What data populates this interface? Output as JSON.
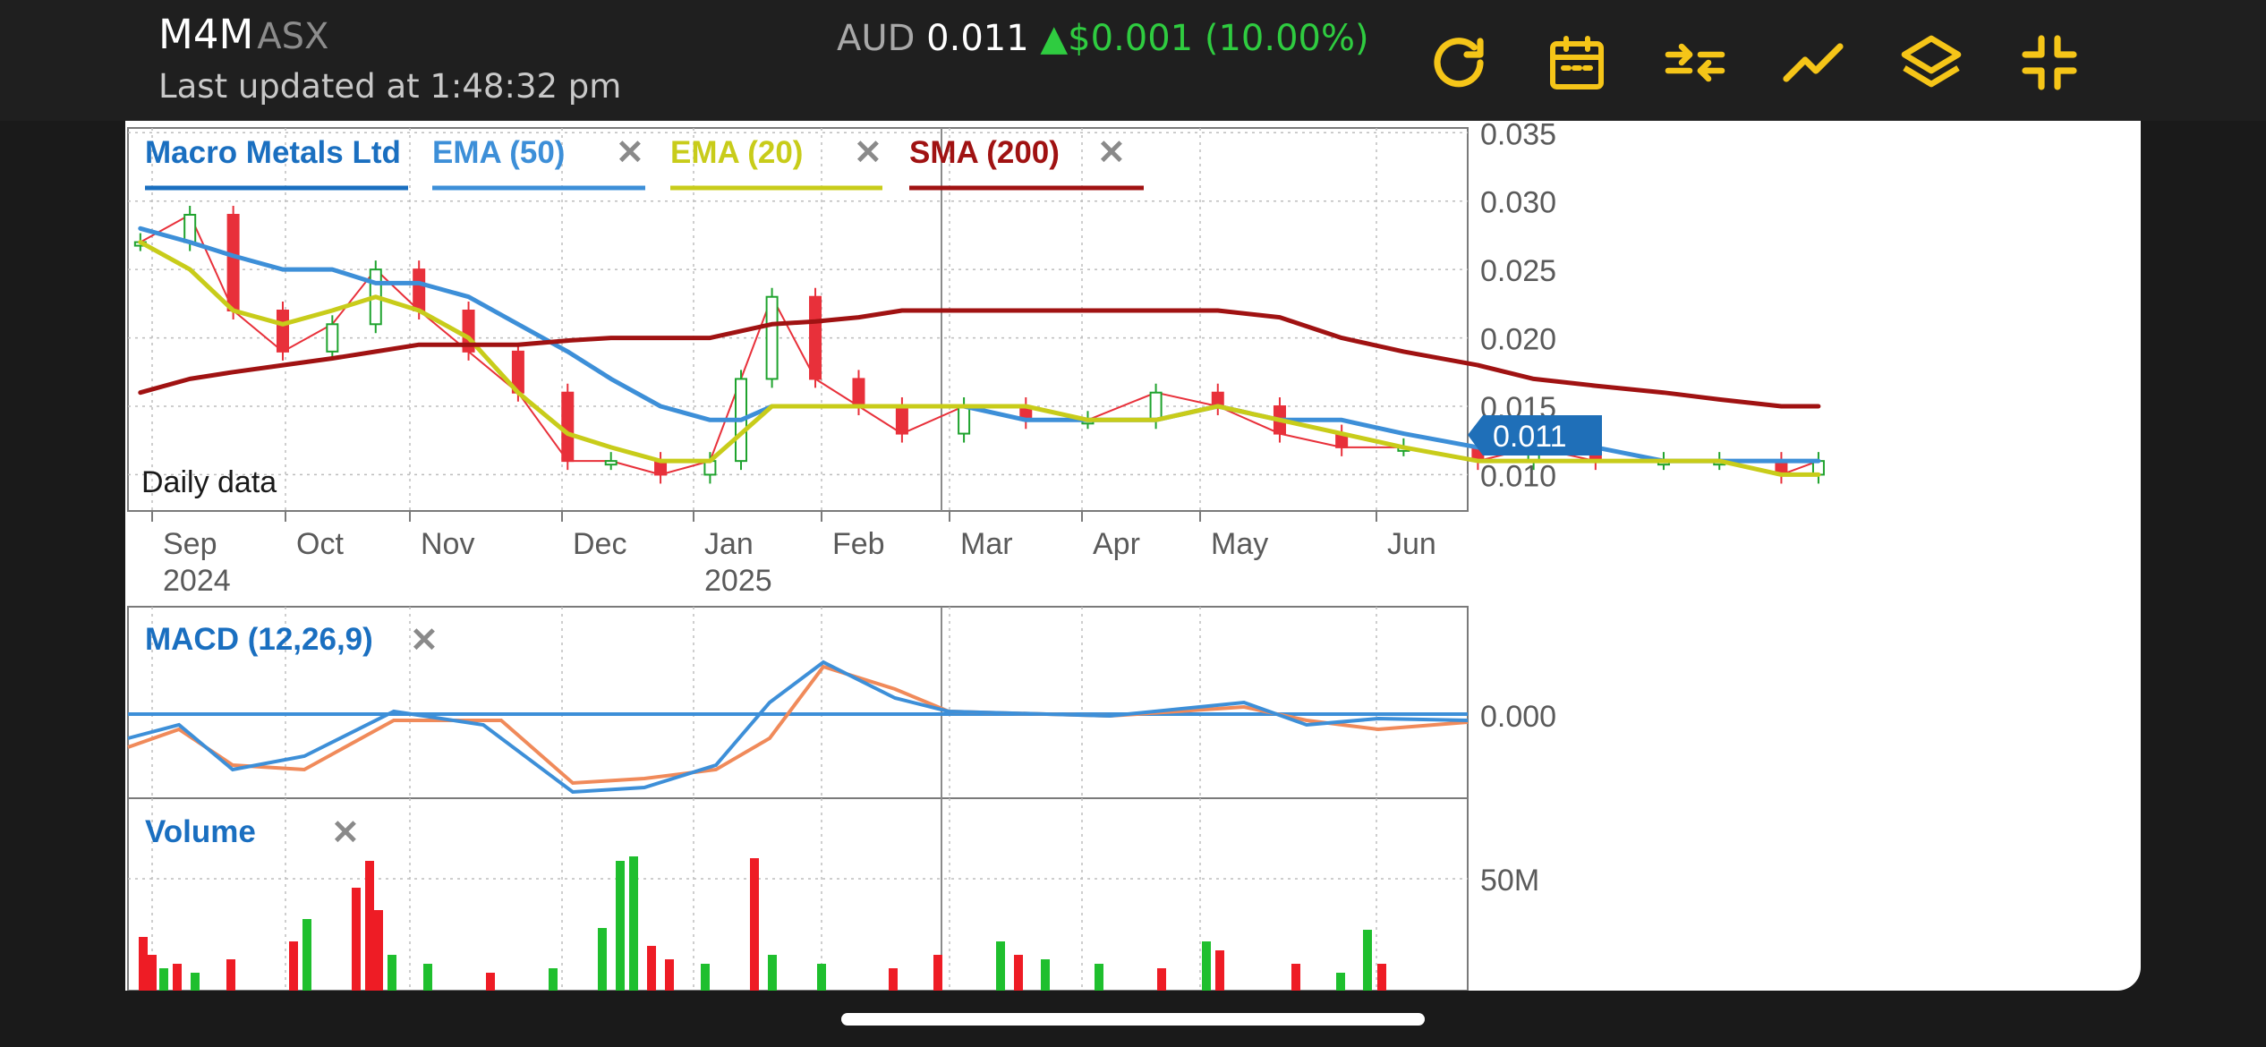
{
  "header": {
    "ticker": "M4M",
    "exchange": "ASX",
    "updated": "Last updated at 1:48:32 pm",
    "currency": "AUD",
    "price": "0.011",
    "change_arrow": "▲",
    "change": "$0.001",
    "change_pct": "(10.00%)"
  },
  "toolbar": {
    "icons": [
      "refresh-icon",
      "calendar-icon",
      "compare-icon",
      "indicator-line-icon",
      "layers-icon",
      "exit-fullscreen-icon"
    ],
    "color": "#f5c518"
  },
  "legend": {
    "items": [
      {
        "label": "Macro Metals Ltd",
        "color": "#1a6fc0",
        "removable": false
      },
      {
        "label": "EMA (50)",
        "color": "#3d8fd8",
        "removable": true
      },
      {
        "label": "EMA (20)",
        "color": "#c8cc1a",
        "removable": true
      },
      {
        "label": "SMA (200)",
        "color": "#a01212",
        "removable": true
      }
    ],
    "close_glyph": "✕"
  },
  "price_panel": {
    "footnote": "Daily data",
    "current_price_tag": "0.011",
    "y_ticks": [
      "0.035",
      "0.030",
      "0.025",
      "0.020",
      "0.015",
      "0.010"
    ],
    "months": [
      {
        "label": "Sep",
        "year": "2024"
      },
      {
        "label": "Oct",
        "year": ""
      },
      {
        "label": "Nov",
        "year": ""
      },
      {
        "label": "Dec",
        "year": ""
      },
      {
        "label": "Jan",
        "year": "2025"
      },
      {
        "label": "Feb",
        "year": ""
      },
      {
        "label": "Mar",
        "year": ""
      },
      {
        "label": "Apr",
        "year": ""
      },
      {
        "label": "May",
        "year": ""
      },
      {
        "label": "Jun",
        "year": ""
      }
    ]
  },
  "macd_panel": {
    "label": "MACD (12,26,9)",
    "y_tick": "0.000"
  },
  "volume_panel": {
    "label": "Volume",
    "y_tick": "50M"
  },
  "chart_data": {
    "type": "line",
    "title": "Macro Metals Ltd",
    "ylim": [
      0.008,
      0.036
    ],
    "x": [
      "2024-08-28",
      "2024-09-05",
      "2024-09-12",
      "2024-09-20",
      "2024-09-28",
      "2024-10-05",
      "2024-10-12",
      "2024-10-20",
      "2024-10-28",
      "2024-11-05",
      "2024-11-12",
      "2024-11-20",
      "2024-11-28",
      "2024-12-03",
      "2024-12-08",
      "2024-12-15",
      "2024-12-22",
      "2024-12-29",
      "2025-01-08",
      "2025-01-18",
      "2025-01-28",
      "2025-02-08",
      "2025-02-18",
      "2025-02-28",
      "2025-03-10",
      "2025-03-20",
      "2025-04-01",
      "2025-04-10",
      "2025-04-20",
      "2025-05-01",
      "2025-05-10",
      "2025-05-20",
      "2025-05-26"
    ],
    "series": [
      {
        "name": "Macro Metals Ltd",
        "color": "#1a6fc0",
        "values": [
          0.027,
          0.029,
          0.022,
          0.019,
          0.021,
          0.025,
          0.022,
          0.019,
          0.016,
          0.011,
          0.011,
          0.01,
          0.011,
          0.017,
          0.023,
          0.017,
          0.015,
          0.013,
          0.015,
          0.014,
          0.014,
          0.016,
          0.015,
          0.013,
          0.012,
          0.012,
          0.011,
          0.012,
          0.011,
          0.011,
          0.011,
          0.01,
          0.011
        ]
      },
      {
        "name": "EMA (50)",
        "color": "#3d8fd8",
        "values": [
          0.028,
          0.027,
          0.026,
          0.025,
          0.025,
          0.024,
          0.024,
          0.023,
          0.021,
          0.019,
          0.017,
          0.015,
          0.014,
          0.014,
          0.015,
          0.015,
          0.015,
          0.015,
          0.015,
          0.014,
          0.014,
          0.014,
          0.015,
          0.014,
          0.014,
          0.013,
          0.012,
          0.012,
          0.012,
          0.011,
          0.011,
          0.011,
          0.011
        ]
      },
      {
        "name": "EMA (20)",
        "color": "#c8cc1a",
        "values": [
          0.027,
          0.025,
          0.022,
          0.021,
          0.022,
          0.023,
          0.022,
          0.02,
          0.016,
          0.013,
          0.012,
          0.011,
          0.011,
          0.013,
          0.015,
          0.015,
          0.015,
          0.015,
          0.015,
          0.015,
          0.014,
          0.014,
          0.015,
          0.014,
          0.013,
          0.012,
          0.011,
          0.011,
          0.011,
          0.011,
          0.011,
          0.01,
          0.01
        ]
      },
      {
        "name": "SMA (200)",
        "color": "#a01212",
        "values": [
          0.016,
          0.017,
          0.0175,
          0.018,
          0.0185,
          0.019,
          0.0195,
          0.0195,
          0.0195,
          0.0198,
          0.02,
          0.02,
          0.02,
          0.0205,
          0.021,
          0.0212,
          0.0215,
          0.022,
          0.022,
          0.022,
          0.022,
          0.022,
          0.022,
          0.0215,
          0.02,
          0.019,
          0.018,
          0.017,
          0.0165,
          0.016,
          0.0155,
          0.015,
          0.015
        ]
      }
    ]
  }
}
